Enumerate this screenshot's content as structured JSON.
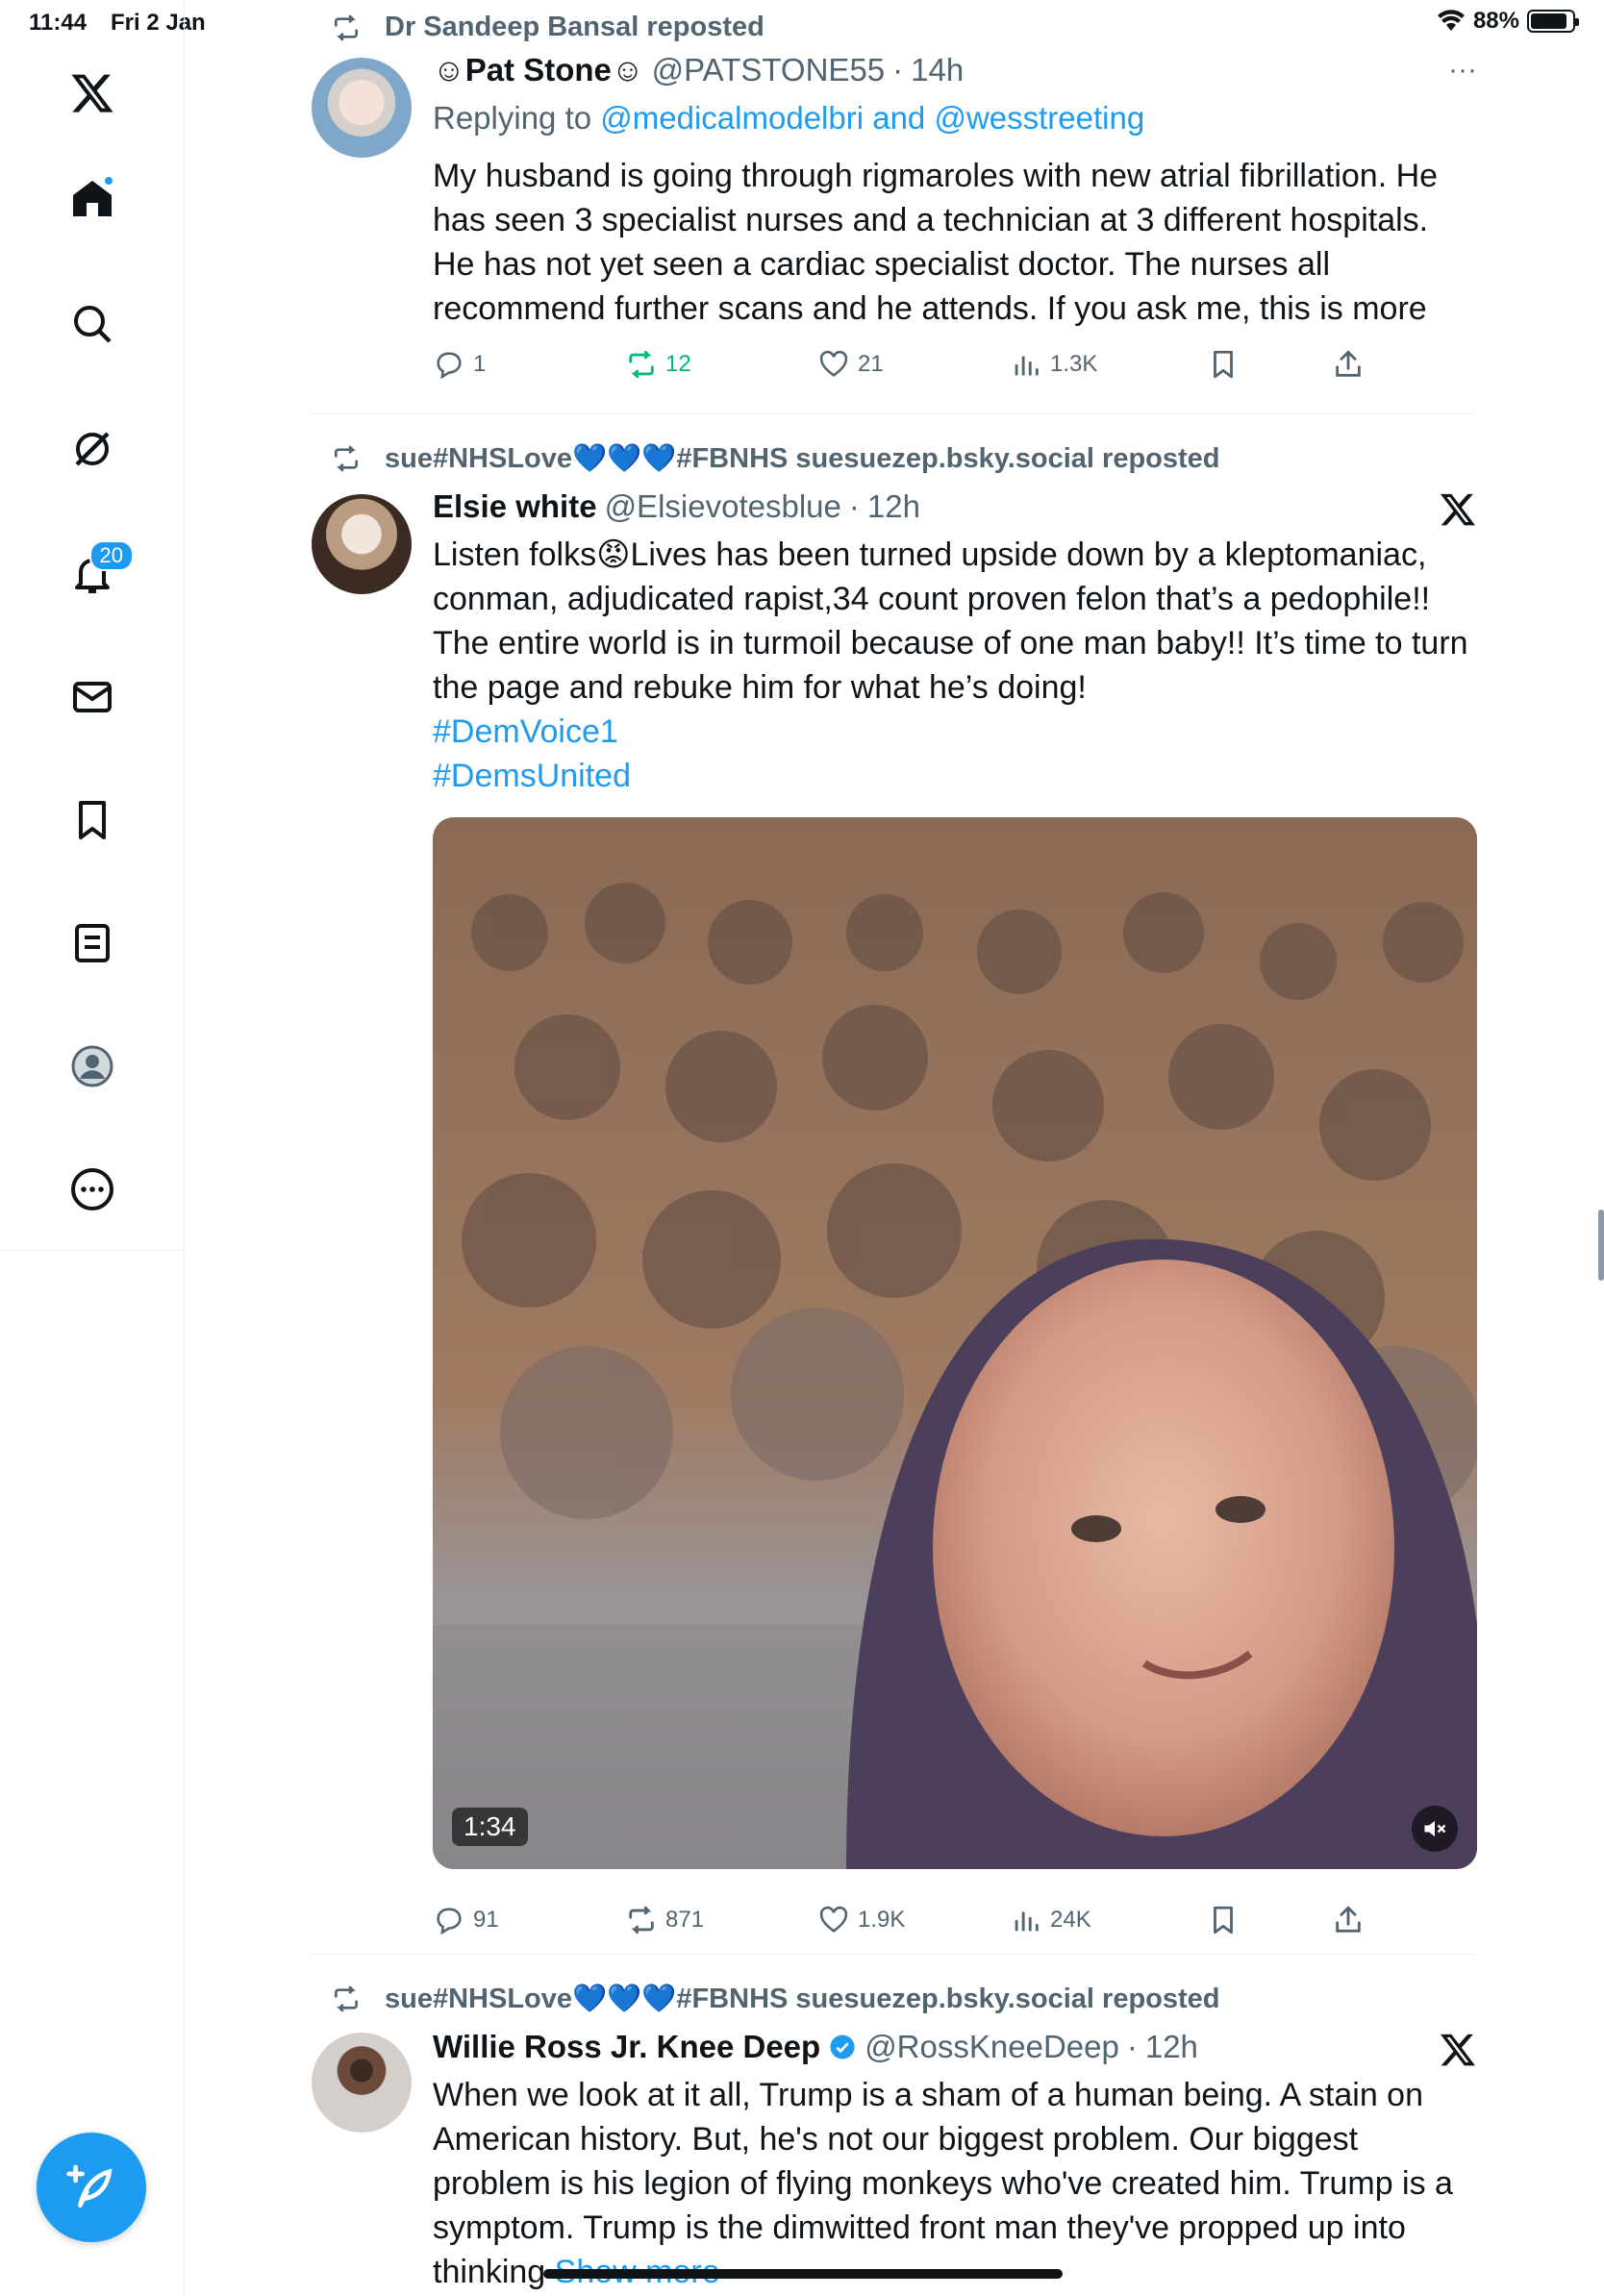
{
  "status_bar": {
    "time": "11:44",
    "date": "Fri 2 Jan",
    "battery": "88%",
    "battery_level": 0.88
  },
  "sidebar": {
    "items": [
      {
        "name": "x-logo",
        "icon": "x-logo-icon"
      },
      {
        "name": "home",
        "icon": "home-icon"
      },
      {
        "name": "search",
        "icon": "search-icon"
      },
      {
        "name": "grok",
        "icon": "grok-icon"
      },
      {
        "name": "notifications",
        "icon": "bell-icon",
        "badge": "20"
      },
      {
        "name": "messages",
        "icon": "mail-icon"
      },
      {
        "name": "bookmarks",
        "icon": "bookmark-icon"
      },
      {
        "name": "lists",
        "icon": "list-icon"
      },
      {
        "name": "profile",
        "icon": "profile-icon"
      },
      {
        "name": "more",
        "icon": "more-icon"
      }
    ]
  },
  "tweets": [
    {
      "reposted_by": "Dr Sandeep Bansal reposted",
      "name": "☺Pat Stone☺",
      "handle": "@PATSTONE55",
      "time": "14h",
      "replying_prefix": "Replying to",
      "replying_to": "@medicalmodelbri and @wesstreeting",
      "text": "My husband is going through rigmaroles with new atrial fibrillation. He has seen 3 specialist nurses and a technician at 3 different hospitals. He has not yet seen a cardiac specialist doctor. The nurses all recommend further scans and he attends. If you ask me, this is more",
      "replies": "1",
      "reposts": "12",
      "likes": "21",
      "views": "1.3K"
    },
    {
      "reposted_by": "sue#NHSLove💙💙💙#FBNHS suesuezep.bsky.social reposted",
      "name": "Elsie white",
      "handle": "@Elsievotesblue",
      "time": "12h",
      "text": "Listen folks😡Lives has been turned upside down by a kleptomaniac, conman, adjudicated rapist,34 count proven felon that’s a pedophile!! The entire world is in turmoil because of one man baby!! It’s time to turn the page and rebuke him for what he’s doing!",
      "hashtags": [
        "#DemVoice1",
        "#DemsUnited"
      ],
      "video_duration": "1:34",
      "replies": "91",
      "reposts": "871",
      "likes": "1.9K",
      "views": "24K"
    },
    {
      "reposted_by": "sue#NHSLove💙💙💙#FBNHS suesuezep.bsky.social reposted",
      "name": "Willie Ross Jr. Knee Deep",
      "handle": "@RossKneeDeep",
      "time": "12h",
      "text": "When we look at it all, Trump is a sham of a human being. A stain on American history. But, he's not our biggest problem. Our biggest problem is his legion of flying monkeys who've created him. Trump is a symptom. Trump is the dimwitted front man they've propped up into thinking",
      "show_more": "Show more"
    }
  ],
  "colors": {
    "accent": "#1d9bf0",
    "repost_green": "#00ba7c",
    "secondary_text": "#536471"
  }
}
